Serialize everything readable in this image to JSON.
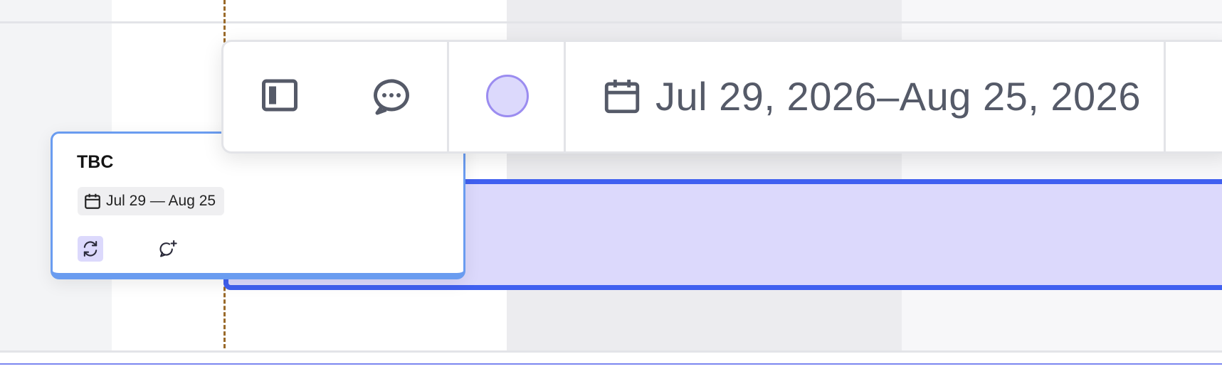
{
  "card": {
    "title": "TBC",
    "date_range": "Jul 29 — Aug 25",
    "icons": {
      "date": "calendar-icon",
      "sync": "refresh-icon",
      "comment": "add-comment-icon"
    }
  },
  "toolbar": {
    "icons": [
      "sidebar-panel-icon",
      "comment-icon",
      "status-circle",
      "calendar-icon",
      "more-vertical-icon"
    ],
    "date_range": "Jul 29, 2026–Aug 25, 2026"
  },
  "colors": {
    "bar_fill": "#dcd9fc",
    "bar_border": "#4060f0",
    "card_border": "#6a9cf0",
    "today_line": "#9a6a2a",
    "status": "#9b8cf0"
  }
}
